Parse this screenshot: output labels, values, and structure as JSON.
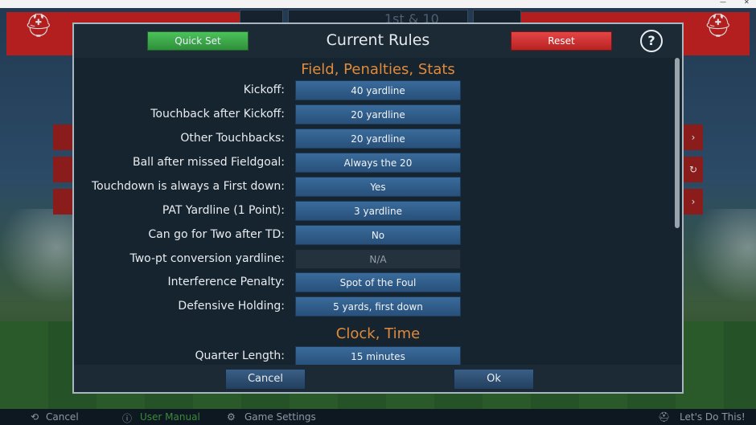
{
  "window": {
    "title": "",
    "controls": [
      "—",
      "✕"
    ]
  },
  "background": {
    "scoreboard_text": "1st & 10",
    "bottom_bar": {
      "cancel_label": "Cancel",
      "manual_label": "User Manual",
      "settings_label": "Game Settings",
      "go_label": "Let's Do This!"
    },
    "side_icons": [
      "›",
      "↻",
      "›"
    ]
  },
  "dialog": {
    "title": "Current Rules",
    "quick_set_label": "Quick Set",
    "reset_label": "Reset",
    "help_label": "?",
    "sections": [
      {
        "heading": "Field, Penalties, Stats",
        "rows": [
          {
            "label": "Kickoff:",
            "value": "40 yardline",
            "enabled": true
          },
          {
            "label": "Touchback after Kickoff:",
            "value": "20 yardline",
            "enabled": true
          },
          {
            "label": "Other Touchbacks:",
            "value": "20 yardline",
            "enabled": true
          },
          {
            "label": "Ball after missed Fieldgoal:",
            "value": "Always the 20",
            "enabled": true
          },
          {
            "label": "Touchdown is always a First down:",
            "value": "Yes",
            "enabled": true
          },
          {
            "label": "PAT Yardline (1 Point):",
            "value": "3 yardline",
            "enabled": true
          },
          {
            "label": "Can go for Two after TD:",
            "value": "No",
            "enabled": true
          },
          {
            "label": "Two-pt conversion yardline:",
            "value": "N/A",
            "enabled": false
          },
          {
            "label": "Interference Penalty:",
            "value": "Spot of the Foul",
            "enabled": true
          },
          {
            "label": "Defensive Holding:",
            "value": "5 yards, first down",
            "enabled": true
          }
        ]
      },
      {
        "heading": "Clock, Time",
        "rows": [
          {
            "label": "Quarter Length:",
            "value": "15 minutes",
            "enabled": true
          }
        ]
      }
    ],
    "cancel_label": "Cancel",
    "ok_label": "Ok"
  }
}
